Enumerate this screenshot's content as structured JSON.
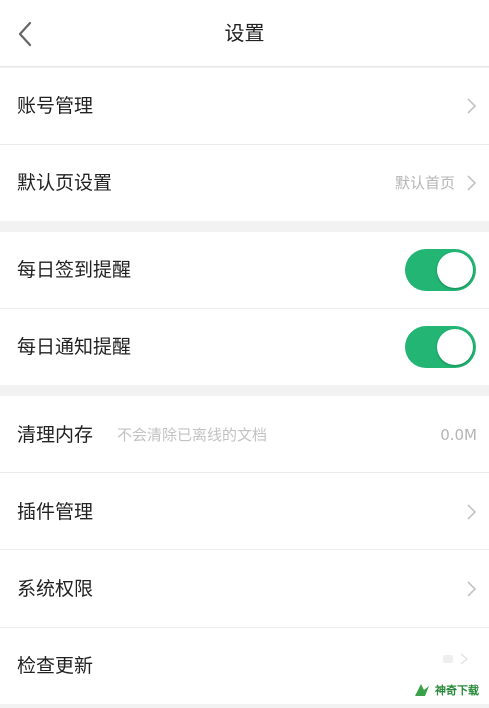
{
  "header": {
    "title": "设置"
  },
  "accent_color": "#22b573",
  "sections": {
    "account": {
      "account_manage": "账号管理",
      "default_page": "默认页设置",
      "default_page_value": "默认首页"
    },
    "reminders": {
      "daily_checkin": "每日签到提醒",
      "daily_checkin_enabled": true,
      "daily_notice": "每日通知提醒",
      "daily_notice_enabled": true
    },
    "system": {
      "clear_cache": "清理内存",
      "clear_cache_hint": "不会清除已离线的文档",
      "clear_cache_value": "0.0M",
      "plugin_manage": "插件管理",
      "system_permissions": "系统权限",
      "check_update": "检查更新"
    }
  },
  "watermark": {
    "text": "神奇下载"
  }
}
